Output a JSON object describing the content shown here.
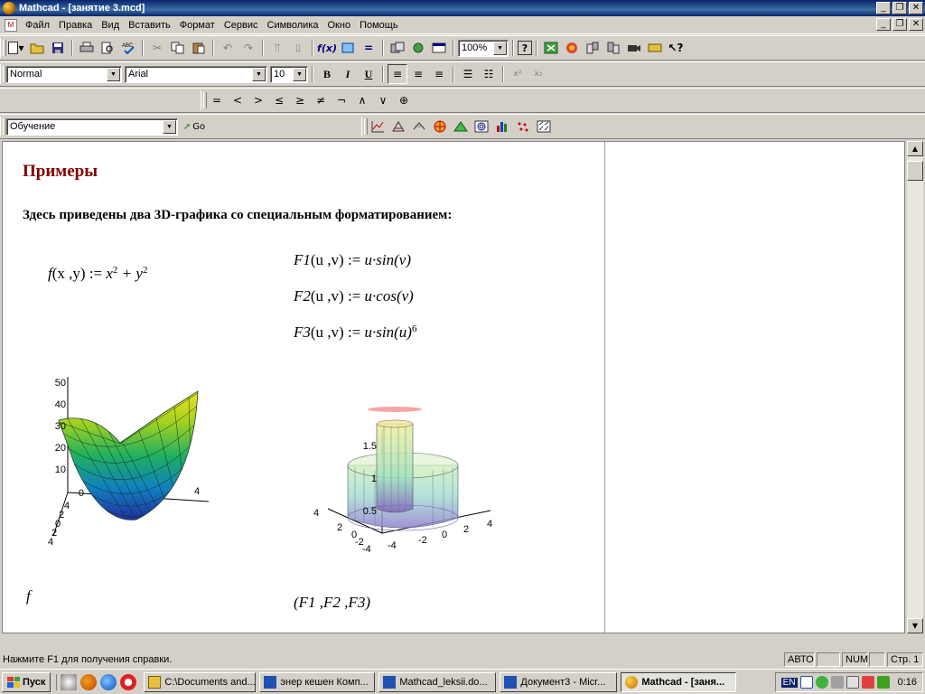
{
  "window": {
    "title": "Mathcad - [занятие 3.mcd]"
  },
  "menu": [
    "Файл",
    "Правка",
    "Вид",
    "Вставить",
    "Формат",
    "Сервис",
    "Символика",
    "Окно",
    "Помощь"
  ],
  "toolbar": {
    "zoom": "100%"
  },
  "format": {
    "style": "Normal",
    "font": "Arial",
    "size": "10",
    "bold": "B",
    "italic": "I",
    "underline": "U"
  },
  "math_toolbar": [
    "=",
    "<",
    ">",
    "≤",
    "≥",
    "≠",
    "¬",
    "∧",
    "∨",
    "⊕"
  ],
  "resources": {
    "selected": "Обучение",
    "go_label": "Go"
  },
  "document": {
    "heading": "Примеры",
    "paragraph": "Здесь приведены два 3D-графика со специальным форматированием:",
    "f_def": {
      "name": "f",
      "args": "(x ,y)",
      "assign": " := ",
      "body": "x",
      "exp1": "2",
      "plus": " + y",
      "exp2": "2"
    },
    "f1_def": {
      "name": "F1",
      "args": "(u ,v)",
      "assign": " := ",
      "body": "u·sin(v)"
    },
    "f2_def": {
      "name": "F2",
      "args": "(u ,v)",
      "assign": " := ",
      "body": "u·cos(v)"
    },
    "f3_def": {
      "name": "F3",
      "args": "(u ,v)",
      "assign": " := ",
      "body": "u·sin(u)",
      "exp": "6"
    },
    "plot1": {
      "z_ticks": [
        "50",
        "40",
        "30",
        "20",
        "10",
        "0"
      ],
      "x_ticks": [
        "4",
        "2",
        "0",
        "2",
        "4"
      ],
      "y_ticks": [
        "4",
        "2",
        "0",
        "2",
        "4"
      ],
      "caption": "f"
    },
    "plot2": {
      "z_ticks": [
        "1.5",
        "1",
        "0.5"
      ],
      "x_ticks": [
        "-4",
        "-2",
        "0",
        "2",
        "4"
      ],
      "y_ticks": [
        "4",
        "2",
        "0",
        "-2",
        "-4"
      ],
      "caption": "(F1 ,F2 ,F3)"
    }
  },
  "status": {
    "message": "Нажмите F1 для получения справки.",
    "mode": "АВТО",
    "num": "NUM",
    "page": "Стр. 1"
  },
  "taskbar": {
    "start": "Пуск",
    "tasks": [
      "C:\\Documents and...",
      "энер кешен Комп...",
      "Mathcad_leksii.do...",
      "Документ3 - Micr...",
      "Mathcad - [заня..."
    ],
    "lang": "EN",
    "clock": "0:16"
  }
}
